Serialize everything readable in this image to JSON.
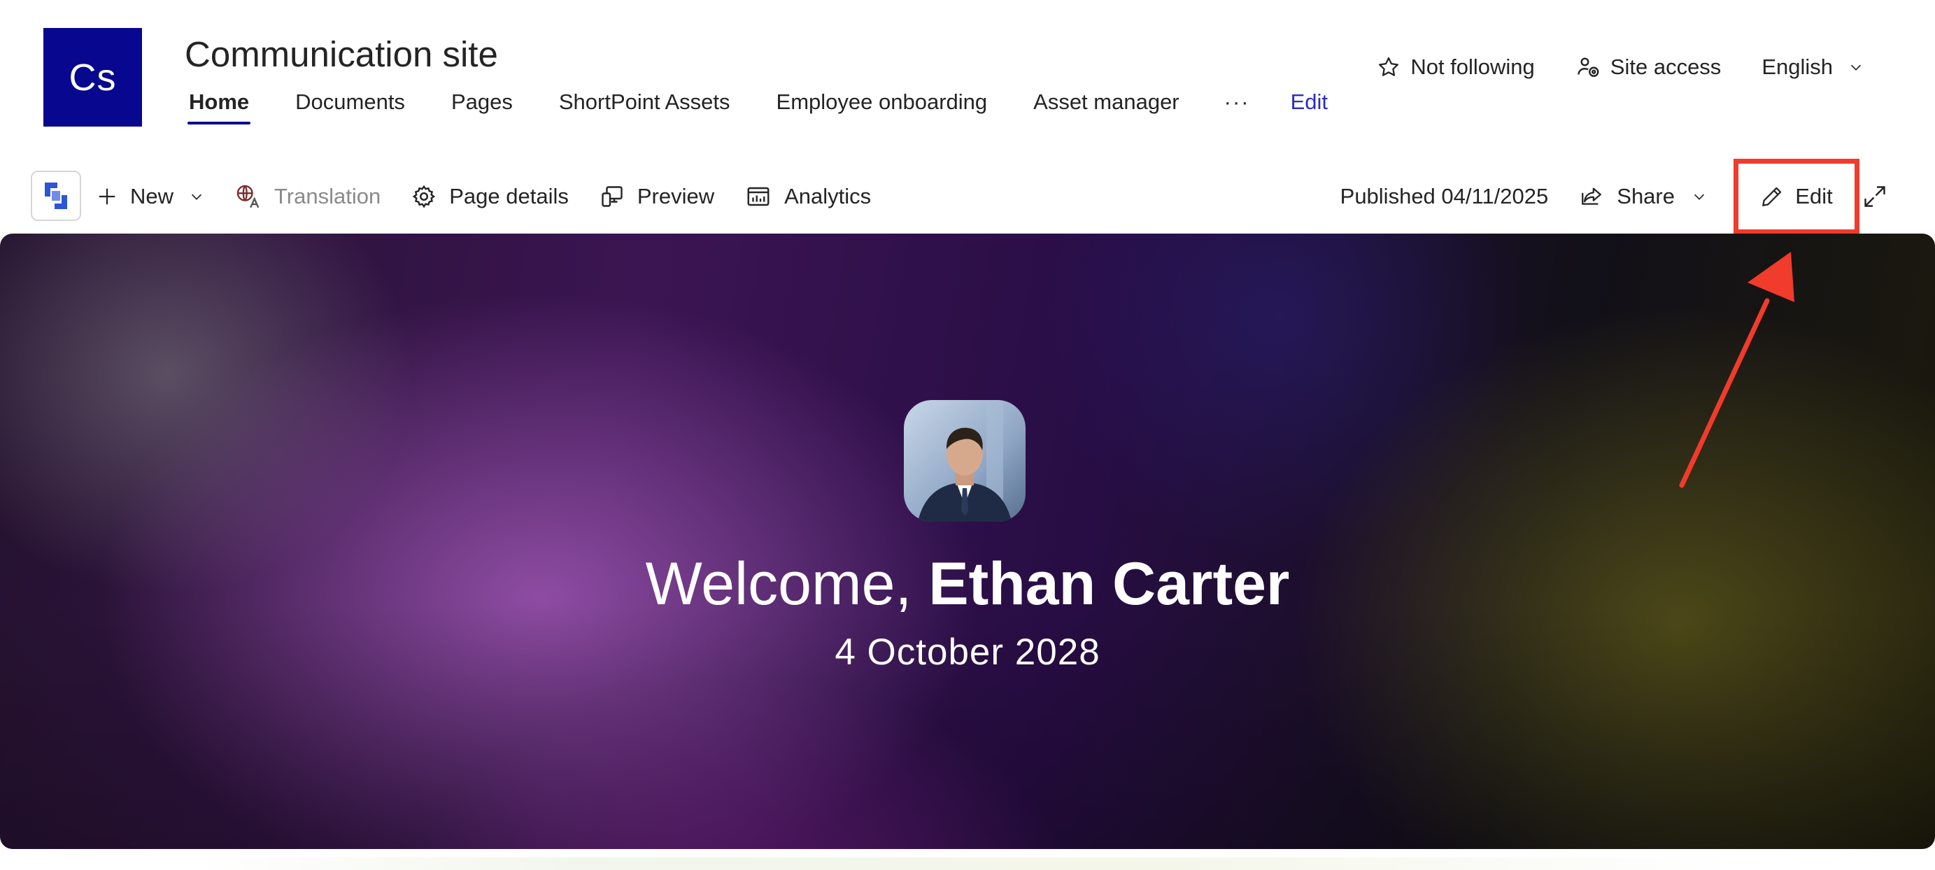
{
  "site": {
    "logo_text": "Cs",
    "title": "Communication site",
    "brand_color": "#07078f"
  },
  "nav": {
    "items": [
      {
        "label": "Home",
        "active": true
      },
      {
        "label": "Documents"
      },
      {
        "label": "Pages"
      },
      {
        "label": "ShortPoint Assets"
      },
      {
        "label": "Employee onboarding"
      },
      {
        "label": "Asset manager"
      }
    ],
    "more_label": "···",
    "edit_label": "Edit"
  },
  "header_actions": {
    "follow_label": "Not following",
    "site_access_label": "Site access",
    "language_label": "English"
  },
  "commandbar": {
    "new_label": "New",
    "translation_label": "Translation",
    "page_details_label": "Page details",
    "preview_label": "Preview",
    "analytics_label": "Analytics",
    "published_label": "Published 04/11/2025",
    "share_label": "Share",
    "edit_label": "Edit"
  },
  "hero": {
    "welcome_prefix": "Welcome, ",
    "user_name": "Ethan Carter",
    "date": "4 October 2028"
  },
  "annotation": {
    "highlight_color": "#f13b2b"
  }
}
